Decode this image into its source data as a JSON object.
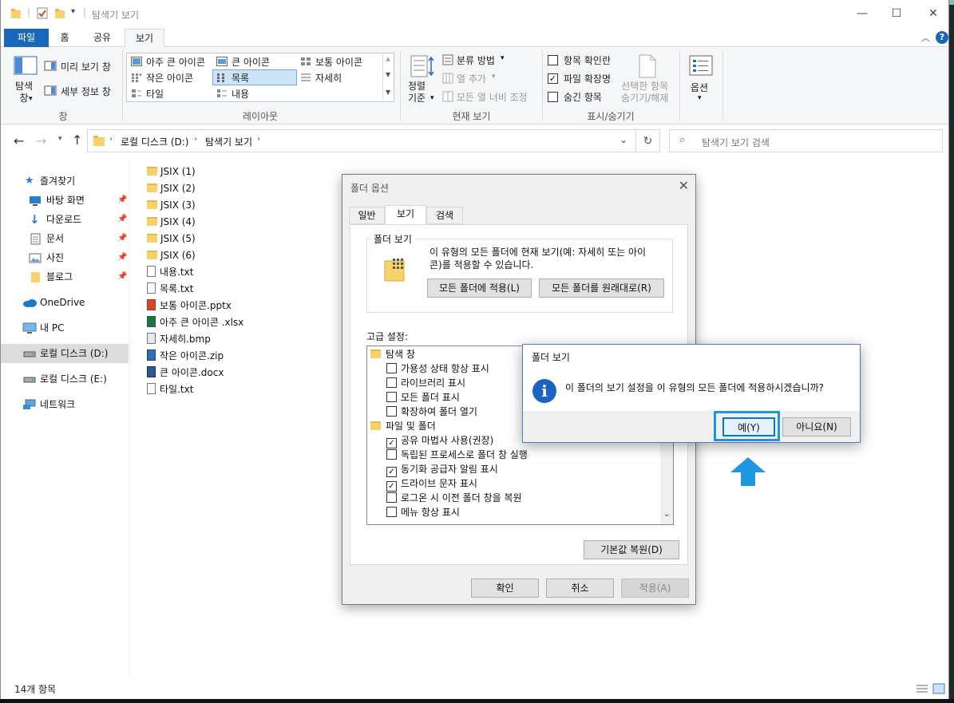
{
  "window": {
    "title": "탐색기 보기",
    "controls": [
      "—",
      "☐",
      "✕"
    ]
  },
  "ribbon_tabs": [
    "파일",
    "홈",
    "공유",
    "보기"
  ],
  "ribbon": {
    "pane": {
      "nav_pane": "탐색\n창",
      "preview": "미리 보기 창",
      "details": "세부 정보 창",
      "group": "창"
    },
    "layout": {
      "items": [
        "아주 큰 아이콘",
        "큰 아이콘",
        "보통 아이콘",
        "작은 아이콘",
        "목록",
        "자세히",
        "타일",
        "내용"
      ],
      "selected": "목록",
      "group": "레이아웃"
    },
    "current_view": {
      "sort_by": "정렬\n기준",
      "group_by": "분류 방법",
      "add_columns": "열 추가",
      "size_columns": "모든 열 너비 조정",
      "group": "현재 보기"
    },
    "show_hide": {
      "item_checkboxes": "항목 확인란",
      "file_ext": "파일 확장명",
      "hidden_items": "숨긴 항목",
      "hide_selected": "선택한 항목\n숨기기/해제",
      "group": "표시/숨기기",
      "item_checkboxes_checked": false,
      "file_ext_checked": true,
      "hidden_items_checked": false
    },
    "options": {
      "label": "옵션"
    }
  },
  "address": {
    "drive": "로컬 디스크 (D:)",
    "folder": "탐색기 보기",
    "search_placeholder": "탐색기 보기 검색"
  },
  "nav": {
    "quick_access": "즐겨찾기",
    "items": [
      "바탕 화면",
      "다운로드",
      "문서",
      "사진",
      "블로그"
    ],
    "onedrive": "OneDrive",
    "this_pc": "내 PC",
    "drive_d": "로컬 디스크 (D:)",
    "drive_e": "로컬 디스크 (E:)",
    "network": "네트워크"
  },
  "files": [
    "JSIX (1)",
    "JSIX (2)",
    "JSIX (3)",
    "JSIX (4)",
    "JSIX (5)",
    "JSIX (6)",
    "내용.txt",
    "목록.txt",
    "보통 아이콘.pptx",
    "아주 큰 아이콘 .xlsx",
    "자세히.bmp",
    "작은 아이콘.zip",
    "큰 아이콘.docx",
    "타일.txt"
  ],
  "status": "14개 항목",
  "folder_options": {
    "title": "폴더 옵션",
    "tabs": [
      "일반",
      "보기",
      "검색"
    ],
    "folder_views_legend": "폴더 보기",
    "folder_views_desc_1": "이 유형의 모든 폴더에 현재 보기(예: 자세히 또는 아이",
    "folder_views_desc_2": "콘)를 적용할 수 있습니다.",
    "apply_to_folders": "모든 폴더에 적용(L)",
    "reset_folders": "모든 폴더를 원래대로(R)",
    "advanced_label": "고급 설정:",
    "tree": {
      "nav_pane_header": "탐색 창",
      "nav_options": [
        {
          "label": "가용성 상태 항상 표시",
          "checked": false
        },
        {
          "label": "라이브러리 표시",
          "checked": false
        },
        {
          "label": "모든 폴더 표시",
          "checked": false
        },
        {
          "label": "확장하여 폴더 열기",
          "checked": false
        }
      ],
      "files_header": "파일 및 폴더",
      "file_options": [
        {
          "label": "공유 마법사 사용(권장)",
          "checked": true
        },
        {
          "label": "독립된 프로세스로 폴더 창 실행",
          "checked": false
        },
        {
          "label": "동기화 공급자 알림 표시",
          "checked": true
        },
        {
          "label": "드라이브 문자 표시",
          "checked": true
        },
        {
          "label": "로그온 시 이전 폴더 창을 복원",
          "checked": false
        },
        {
          "label": "메뉴 항상 표시",
          "checked": false
        }
      ]
    },
    "restore_defaults": "기본값 복원(D)",
    "ok": "확인",
    "cancel": "취소",
    "apply": "적용(A)"
  },
  "confirm": {
    "title": "폴더 보기",
    "message": "이 폴더의 보기 설정을 이 유형의 모든 폴더에 적용하시겠습니까?",
    "yes": "예(Y)",
    "no": "아니요(N)"
  },
  "colors": {
    "accent": "#1a66b8",
    "highlight": "#1f96e0",
    "info": "#1d63c4"
  }
}
